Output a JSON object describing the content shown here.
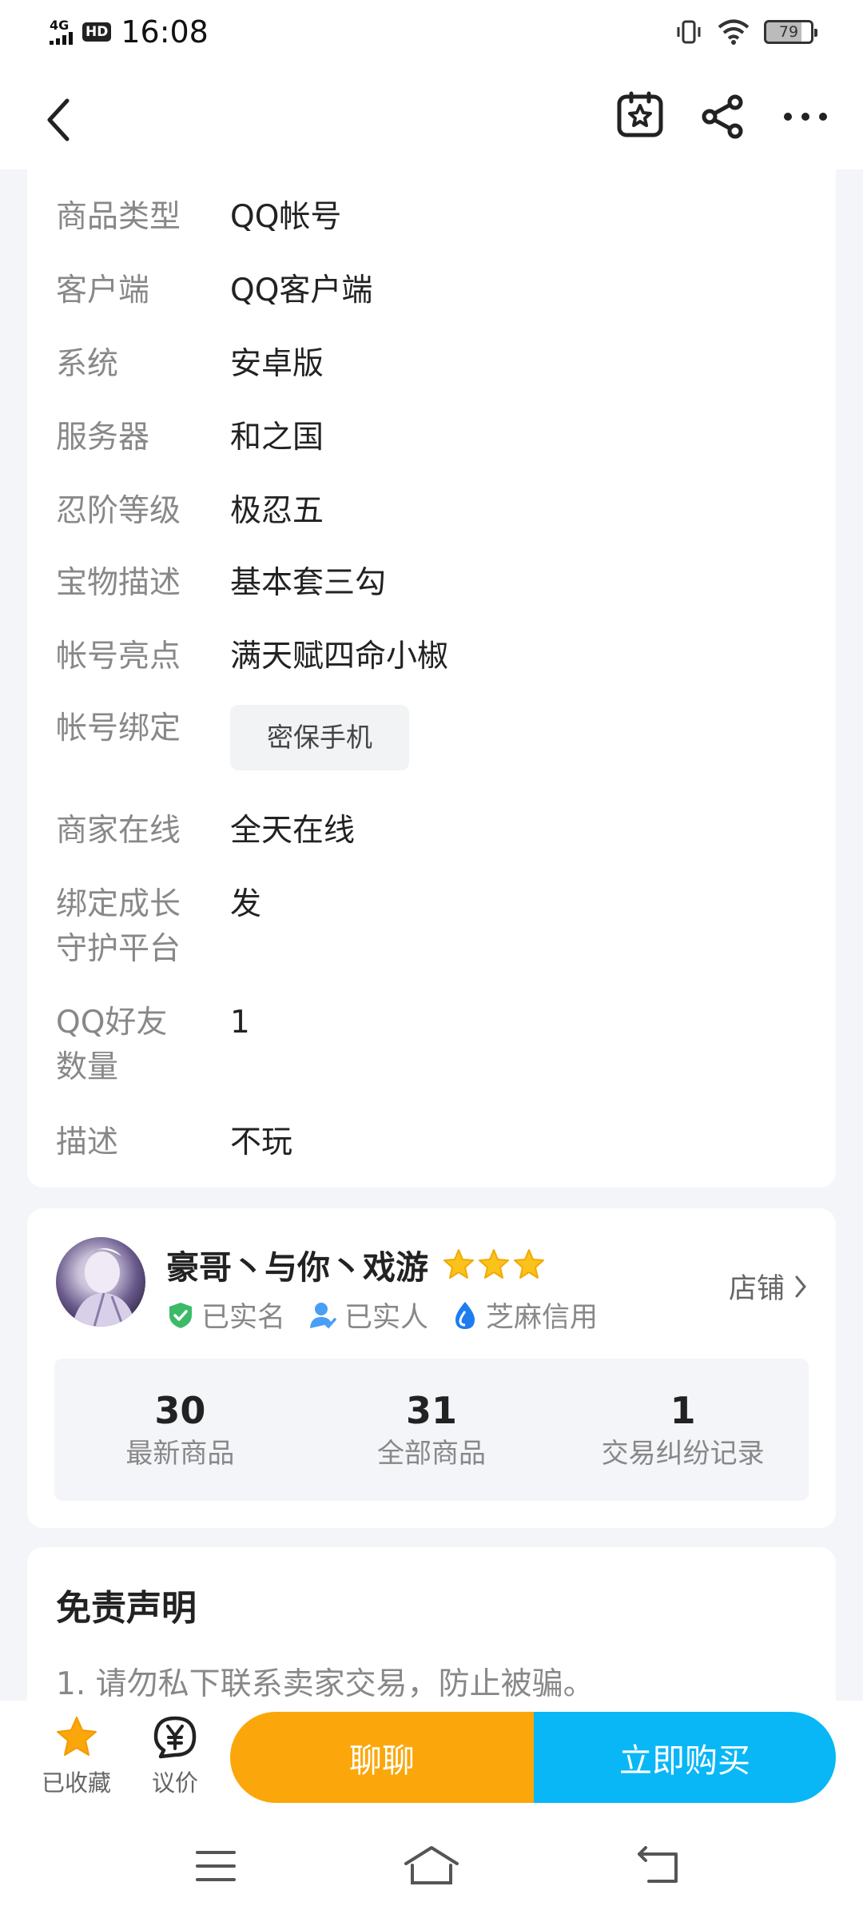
{
  "status_bar": {
    "network": "4G",
    "hd": "HD",
    "time": "16:08",
    "battery": "79"
  },
  "details": [
    {
      "label": "商品类型",
      "value": "QQ帐号"
    },
    {
      "label": "客户端",
      "value": "QQ客户端"
    },
    {
      "label": "系统",
      "value": "安卓版"
    },
    {
      "label": "服务器",
      "value": "和之国"
    },
    {
      "label": "忍阶等级",
      "value": "极忍五"
    },
    {
      "label": "宝物描述",
      "value": "基本套三勾"
    },
    {
      "label": "帐号亮点",
      "value": "满天赋四命小椒"
    },
    {
      "label": "帐号绑定",
      "value": "密保手机"
    },
    {
      "label": "商家在线",
      "value": "全天在线"
    },
    {
      "label_line1": "绑定成长",
      "label_line2": "守护平台",
      "value": "发"
    },
    {
      "label_line1": "QQ好友",
      "label_line2": "数量",
      "value": "1"
    },
    {
      "label": "描述",
      "value": "不玩"
    }
  ],
  "seller": {
    "name": "豪哥丶与你丶戏游",
    "star_count": 3,
    "badges": [
      "已实名",
      "已实人",
      "芝麻信用"
    ],
    "shop_link": "店铺",
    "stats": [
      {
        "num": "30",
        "label": "最新商品"
      },
      {
        "num": "31",
        "label": "全部商品"
      },
      {
        "num": "1",
        "label": "交易纠纷记录"
      }
    ]
  },
  "disclaimer": {
    "title": "免责声明",
    "line1": "1. 请勿私下联系卖家交易，防止被骗。"
  },
  "bottom_bar": {
    "favorited": "已收藏",
    "bargain": "议价",
    "chat": "聊聊",
    "buy": "立即购买"
  },
  "colors": {
    "chat_button": "#fba70b",
    "buy_button": "#09b7f6",
    "star": "#fbc21b"
  }
}
